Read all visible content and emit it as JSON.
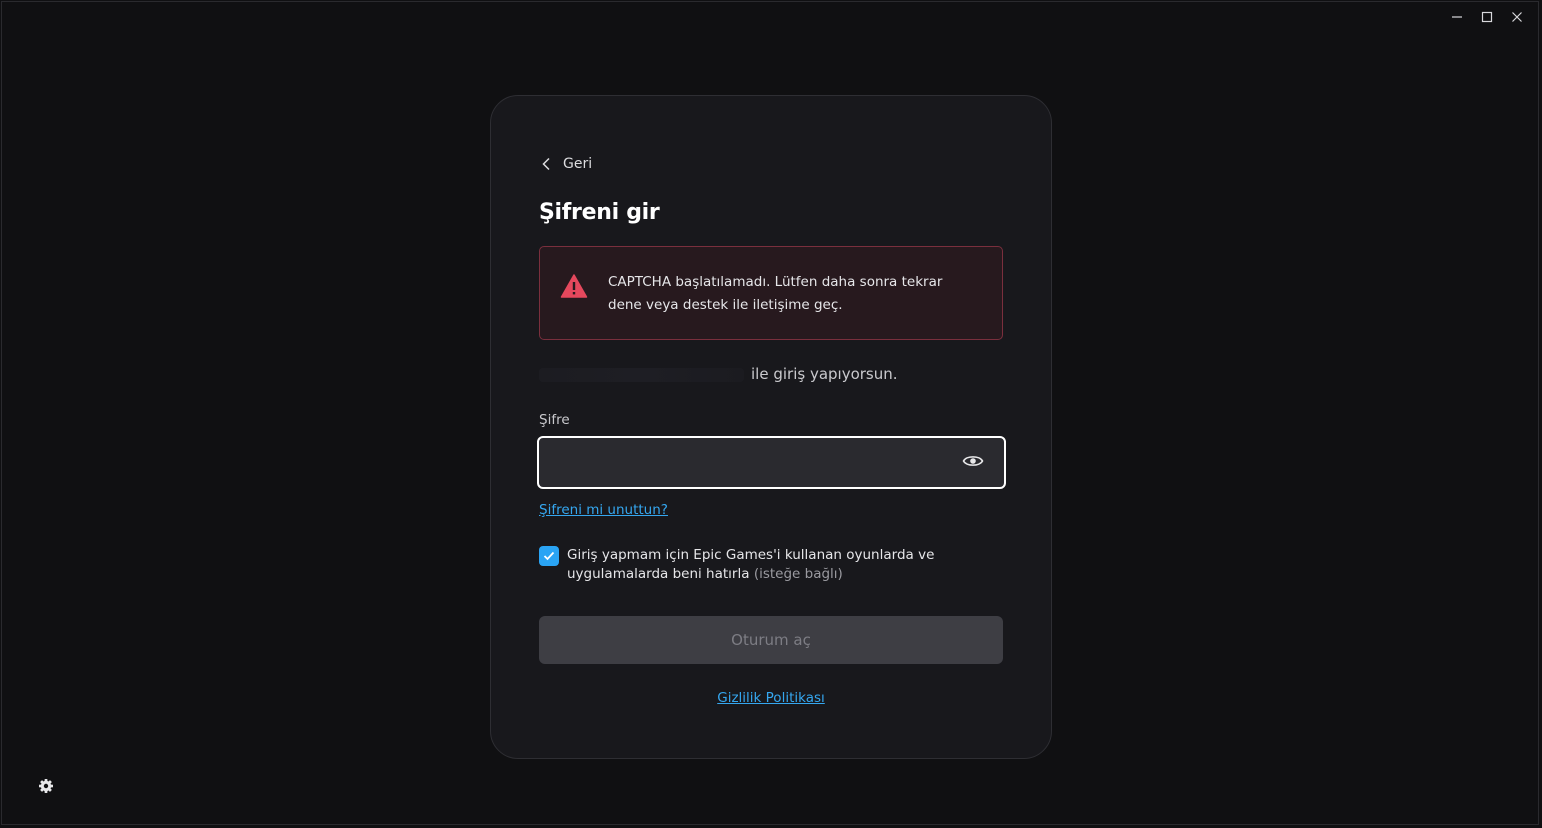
{
  "window": {
    "minimize_icon": "minimize-icon",
    "maximize_icon": "maximize-icon",
    "close_icon": "close-icon"
  },
  "login": {
    "back_label": "Geri",
    "title": "Şifreni gir",
    "alert": {
      "icon": "warning-triangle-icon",
      "message": "CAPTCHA başlatılamadı. Lütfen daha sonra tekrar dene veya destek ile iletişime geç."
    },
    "signing_in_suffix": "ile giriş yapıyorsun.",
    "password_label": "Şifre",
    "password_value": "",
    "forgot_link": "Şifreni mi unuttun?",
    "remember": {
      "checked": true,
      "label": "Giriş yapmam için Epic Games'i kullanan oyunlarda ve uygulamalarda beni hatırla",
      "optional": "(isteğe bağlı)"
    },
    "signin_button": "Oturum aç",
    "privacy_link": "Gizlilik Politikası"
  },
  "colors": {
    "accent": "#2aa4f4",
    "error_border": "#7a2f3d",
    "error_icon": "#e5485d"
  }
}
